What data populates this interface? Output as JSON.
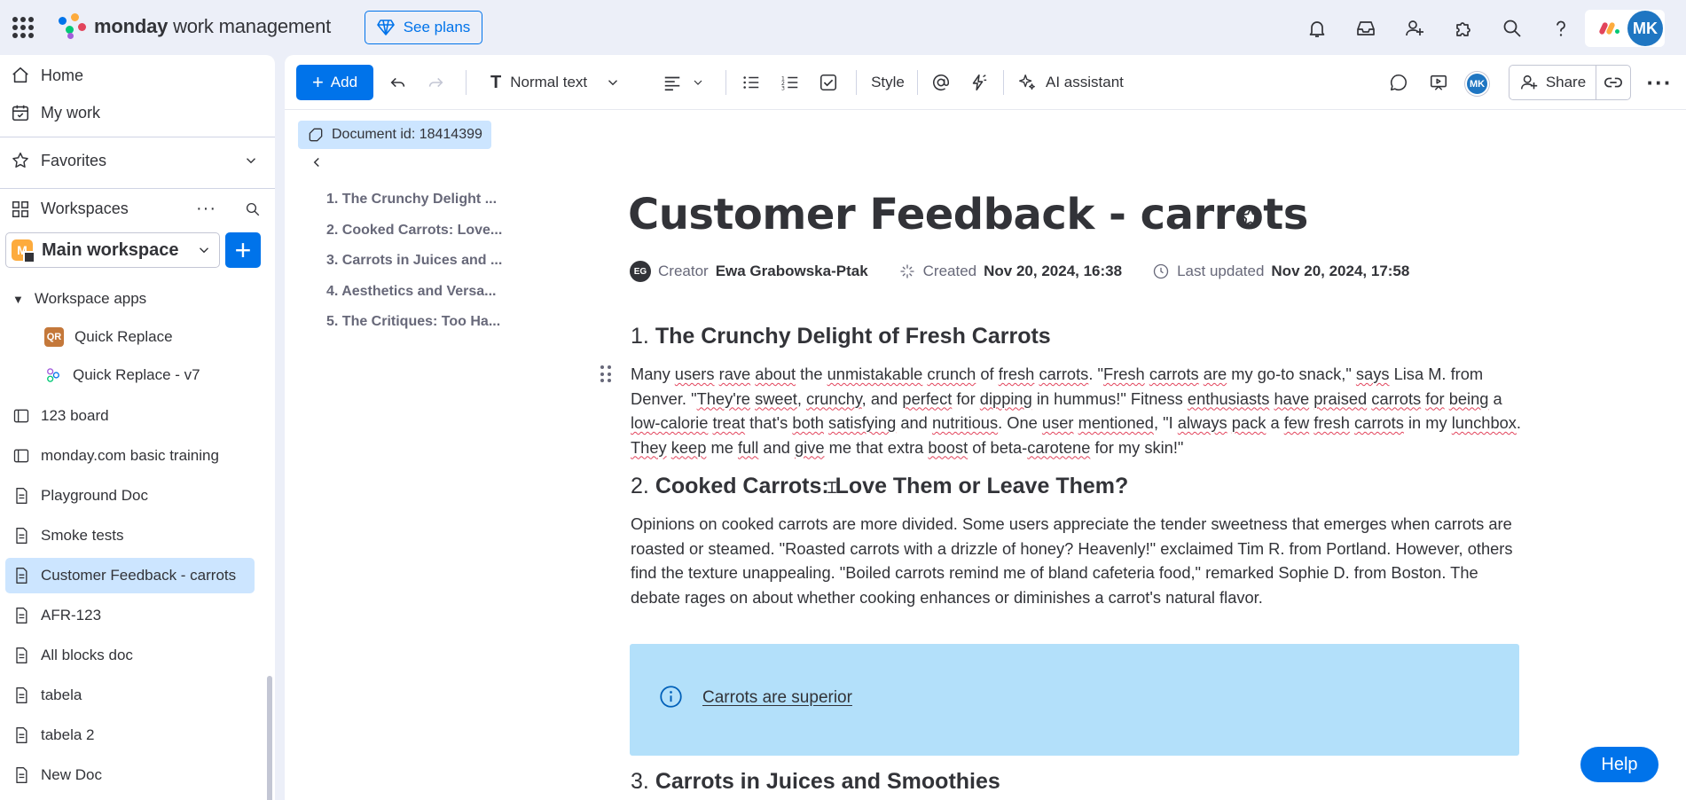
{
  "topbar": {
    "brand_bold": "monday",
    "brand_rest": " work management",
    "see_plans": "See plans",
    "avatar_initials": "MK"
  },
  "sidebar": {
    "home": "Home",
    "my_work": "My work",
    "favorites": "Favorites",
    "workspaces": "Workspaces",
    "workspace_badge": "M",
    "workspace_name": "Main workspace",
    "workspace_apps": "Workspace apps",
    "apps": [
      {
        "label": "Quick Replace",
        "badge": "QR"
      },
      {
        "label": "Quick Replace - v7"
      }
    ],
    "items": [
      {
        "label": "123 board"
      },
      {
        "label": "monday.com basic training"
      },
      {
        "label": "Playground Doc"
      },
      {
        "label": "Smoke tests"
      },
      {
        "label": "Customer Feedback - carrots"
      },
      {
        "label": "AFR-123"
      },
      {
        "label": "All blocks doc"
      },
      {
        "label": "tabela"
      },
      {
        "label": "tabela 2"
      },
      {
        "label": "New Doc"
      }
    ]
  },
  "toolbar": {
    "add": "Add",
    "text_style": "Normal text",
    "style": "Style",
    "ai": "AI assistant",
    "avatar": "MK",
    "share": "Share"
  },
  "doc": {
    "id_label": "Document id: 18414399",
    "toc": [
      "1. The Crunchy Delight ...",
      "2. Cooked Carrots: Love...",
      "3. Carrots in Juices and ...",
      "4. Aesthetics and Versa...",
      "5. The Critiques: Too Ha..."
    ],
    "title": "Customer Feedback - carrots",
    "creator_initials": "EG",
    "creator_label": "Creator",
    "creator_name": "Ewa Grabowska-Ptak",
    "created_label": "Created",
    "created_value": "Nov 20, 2024, 16:38",
    "updated_label": "Last updated",
    "updated_value": "Nov 20, 2024, 17:58",
    "sections": [
      {
        "num": "1.",
        "heading": "The Crunchy Delight of Fresh Carrots"
      },
      {
        "num": "2.",
        "heading": "Cooked Carrots: Love Them or Leave Them?"
      },
      {
        "num": "3.",
        "heading": "Carrots in Juices and Smoothies"
      }
    ],
    "para2": "Opinions on cooked carrots are more divided. Some users appreciate the tender sweetness that emerges when carrots are roasted or steamed. \"Roasted carrots with a drizzle of honey? Heavenly!\" exclaimed Tim R. from Portland. However, others find the texture unappealing. \"Boiled carrots remind me of bland cafeteria food,\" remarked Sophie D. from Boston. The debate rages on about whether cooking enhances or diminishes a carrot's natural flavor.",
    "callout": "Carrots are superior"
  },
  "help": "Help"
}
